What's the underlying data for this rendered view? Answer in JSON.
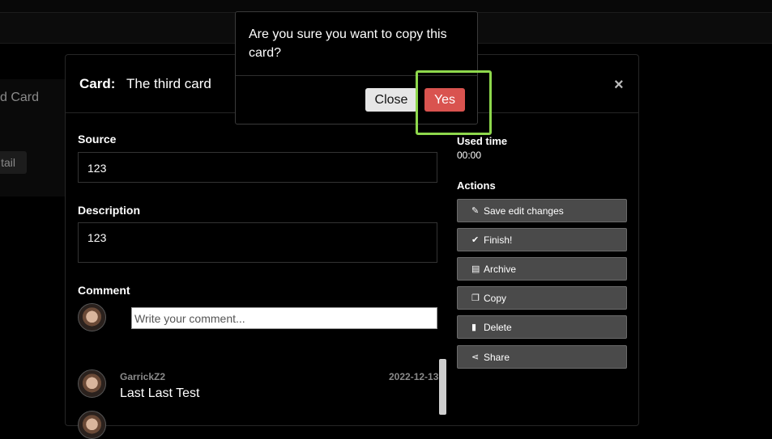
{
  "background": {
    "card_title_fragment": "d Card",
    "detail_button_fragment": "tail"
  },
  "modal": {
    "title_label": "Card:",
    "title_value": "The third card",
    "close_symbol": "×",
    "source": {
      "label": "Source",
      "value": "123"
    },
    "description": {
      "label": "Description",
      "value": "123"
    },
    "comment": {
      "label": "Comment",
      "placeholder": "Write your comment...",
      "entries": [
        {
          "author": "GarrickZ2",
          "date": "2022-12-13",
          "text": "Last Last Test"
        }
      ]
    },
    "sidebar": {
      "used_time_label": "Used time",
      "used_time_value": "00:00",
      "actions_label": "Actions",
      "actions": [
        {
          "label": "Save edit changes",
          "icon": "pencil-icon"
        },
        {
          "label": "Finish!",
          "icon": "check-circle-icon"
        },
        {
          "label": "Archive",
          "icon": "archive-icon"
        },
        {
          "label": "Copy",
          "icon": "copy-icon"
        },
        {
          "label": "Delete",
          "icon": "trash-icon"
        },
        {
          "label": "Share",
          "icon": "share-icon"
        }
      ]
    }
  },
  "confirm_dialog": {
    "message": "Are you sure you want to copy this card?",
    "close_label": "Close",
    "yes_label": "Yes"
  },
  "colors": {
    "yes_button": "#d9534f",
    "highlight": "#8ed84c",
    "action_button": "#4a4a4a"
  }
}
